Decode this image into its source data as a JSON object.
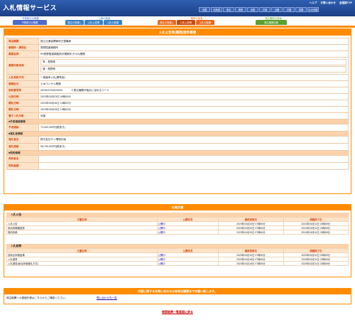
{
  "header": {
    "logo": "入札情報サービス",
    "links": [
      "ヘルプ",
      "お問い合わせ",
      "全国版TOP"
    ],
    "regions": [
      "全国",
      "北海道",
      "東北",
      "関東",
      "北陸",
      "中部",
      "近畿",
      "中国",
      "四国",
      "九州沖縄"
    ]
  },
  "nav": {
    "groups": [
      {
        "label": "予算執行の概要",
        "buttons": [
          "予算執行の概要"
        ],
        "color": "#4d6cc9"
      },
      {
        "label": "工事の検索",
        "buttons": [
          "発注の見通し",
          "入札公告等",
          "入札の結果"
        ],
        "color": "#3b82c4"
      },
      {
        "label": "業務の検索",
        "buttons": [
          "発注の見通し",
          "入札公告等",
          "入札の結果"
        ],
        "color": "#e56b1f"
      },
      {
        "label": "発注機関の検索",
        "buttons": [
          "発注機関情報"
        ],
        "color": "#5aa02c"
      }
    ]
  },
  "detail": {
    "title": "入札公告等(業務)案件概要",
    "rows": {
      "orderer_label": "発注機関",
      "orderer_value": "国土交通省関東地方整備局",
      "office_label": "事務所・課等名",
      "office_value": "長野国道事務所",
      "project_label": "業務名称",
      "project_value": "R5長野国道調査設計業務外(その5)業務",
      "target_label": "業務対象地域",
      "target_values": [
        "長・長野県",
        "道・長野県"
      ],
      "method_label": "入札契約方式",
      "method_value": "一般競争入札(標準型)",
      "category_label": "業務区分",
      "category_value": "土木コンサル業務",
      "number_label": "契約番号等",
      "number_value": "20230370/5020003",
      "number_note": "※発注機関が独自に定めるコード",
      "announce_label": "公告日時",
      "announce_value": "2023年03月23日 09時00分",
      "open_label": "開札日時",
      "open_value": "2023年05月16日 15時00分",
      "bid_label": "開札日時",
      "bid_value": "2023年05月15日 15時00分",
      "ebid_label": "電子入札対象",
      "ebid_value": "対象"
    },
    "estimate_section": "■予定価格情報",
    "estimate_label": "予定価格",
    "estimate_value": "73,400,000円(税抜き)",
    "winner_section": "■落札者情報",
    "winner_name_label": "落札者名",
    "winner_name_value": "株式会社サン環境計画",
    "winner_price_label": "落札価格",
    "winner_price_value": "58,700,000円(税抜き)",
    "contract_section": "■契約情報",
    "contract_party_label": "契約者名",
    "contract_amount_label": "契約金額"
  },
  "documents": {
    "title": "公開文書",
    "col_headers": [
      "文書名称",
      "公開状況",
      "最終更新日",
      "掲載終了日"
    ],
    "announce": {
      "head": "入札公告",
      "rows": [
        [
          "入札公告",
          "公開中",
          "2023年03月23日 07時50分",
          "2024年03月31日 23時59分"
        ],
        [
          "参加資格確認書",
          "公開中",
          "2023年04月20日 07時50分",
          "2024年03月31日 23時59分"
        ],
        [
          "契約約款",
          "公開中",
          "2023年04月20日 07時50分",
          "2024年03月31日 23時59分"
        ]
      ]
    },
    "results": {
      "head": "入札結果",
      "rows": [
        [
          "技術点評価結果",
          "公開中",
          "2023年04月19日 07時50分",
          "2025年03月31日 23時59分"
        ],
        [
          "入札調書",
          "公開中",
          "2023年04月18日 07時50分",
          "2025年03月31日 23時59分"
        ],
        [
          "入札調書(総合評価落札方式)",
          "公開中",
          "2023年04月18日 07時50分",
          "2025年03月31日 23時59分"
        ]
      ]
    }
  },
  "contact": {
    "title": "内容に関するお問い合わせは各発注機関までお願い致します。",
    "row_text": "発注機関への連絡先等はこちらからご確認ください。",
    "link": "問い合わせ先一覧"
  },
  "back_link": "検索結果一覧画面に戻る"
}
